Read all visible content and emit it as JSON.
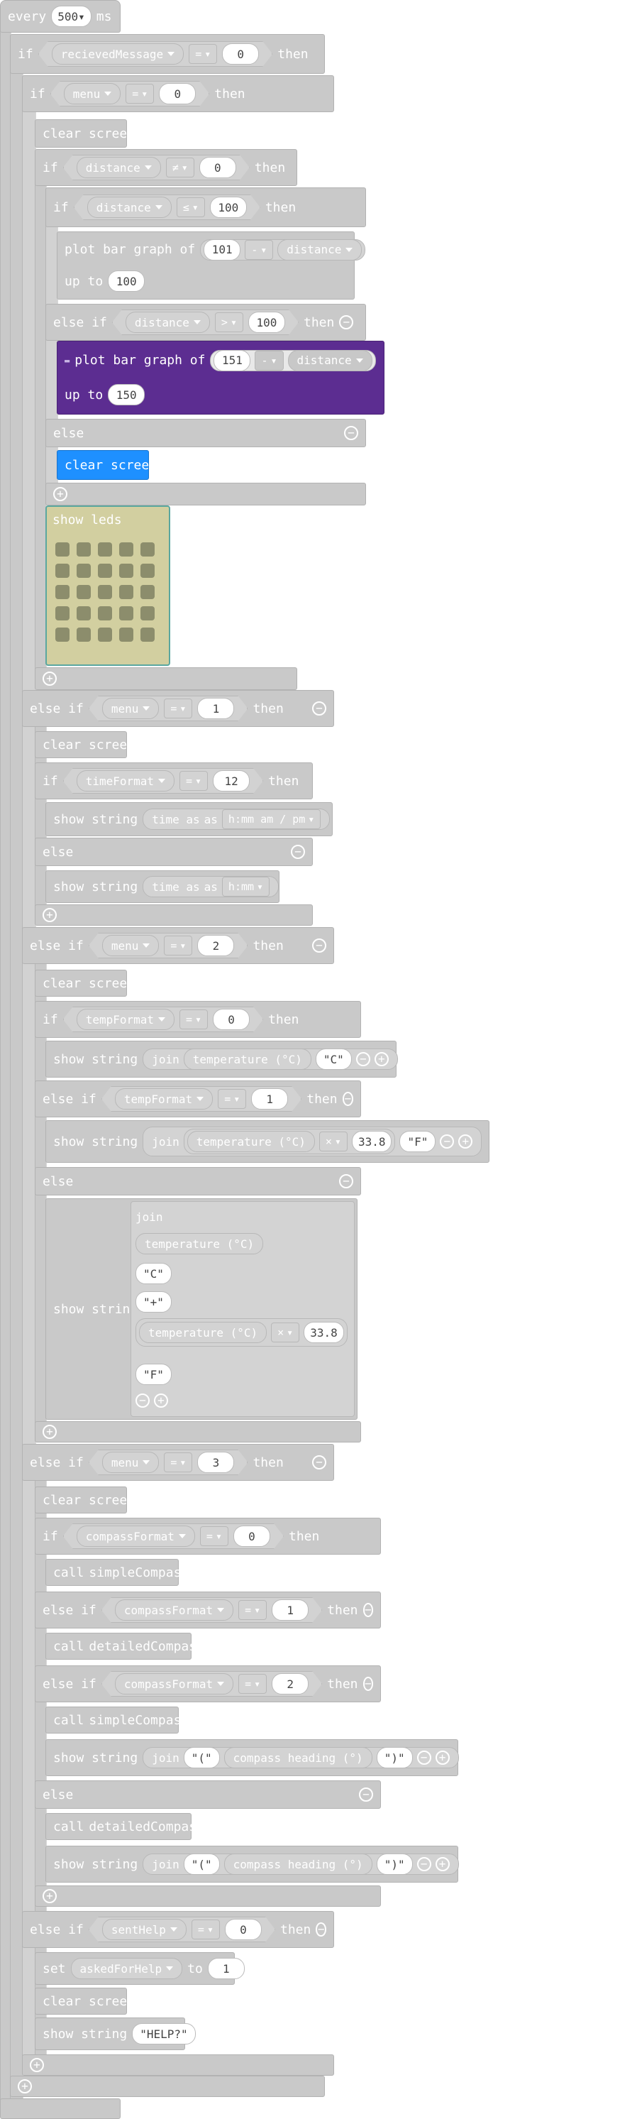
{
  "every": {
    "kw": "every",
    "ms": "500",
    "unit": "ms"
  },
  "kw": {
    "if": "if",
    "then": "then",
    "else": "else",
    "else_if": "else if",
    "up_to": "up to",
    "clear": "clear screen",
    "plot": "plot bar graph of",
    "show_string": "show string",
    "show_leds": "show leds",
    "join": "join",
    "call": "call",
    "set": "set",
    "to": "to"
  },
  "vars": {
    "recv": "recievedMessage",
    "menu": "menu",
    "distance": "distance",
    "timeFormat": "timeFormat",
    "tempFormat": "tempFormat",
    "compassFormat": "compassFormat",
    "sentHelp": "sentHelp",
    "askedForHelp": "askedForHelp"
  },
  "ops": {
    "eq": "=",
    "neq": "≠",
    "le": "≤",
    "gt": ">",
    "minus": "-",
    "times": "×"
  },
  "nums": {
    "n0": "0",
    "n1": "1",
    "n2": "2",
    "n3": "3",
    "n12": "12",
    "n100": "100",
    "n101": "101",
    "n150": "150",
    "n151": "151",
    "n338": "33.8"
  },
  "text": {
    "time_as": "time as",
    "as": "as",
    "fmt_12": "h:mm am / pm",
    "fmt_24": "h:mm",
    "temperature": "temperature (°C)",
    "c": "\"C\"",
    "f": "\"F\"",
    "plus": "\"+\"",
    "compass": "compass heading (°)",
    "lparen": "\"(\"",
    "rparen": "\")\"",
    "simple": "simpleCompass",
    "detailed": "detailedCompass",
    "help": "\"HELP?\""
  },
  "icons": {
    "minus": "−",
    "plus": "+",
    "comment": "▬"
  }
}
